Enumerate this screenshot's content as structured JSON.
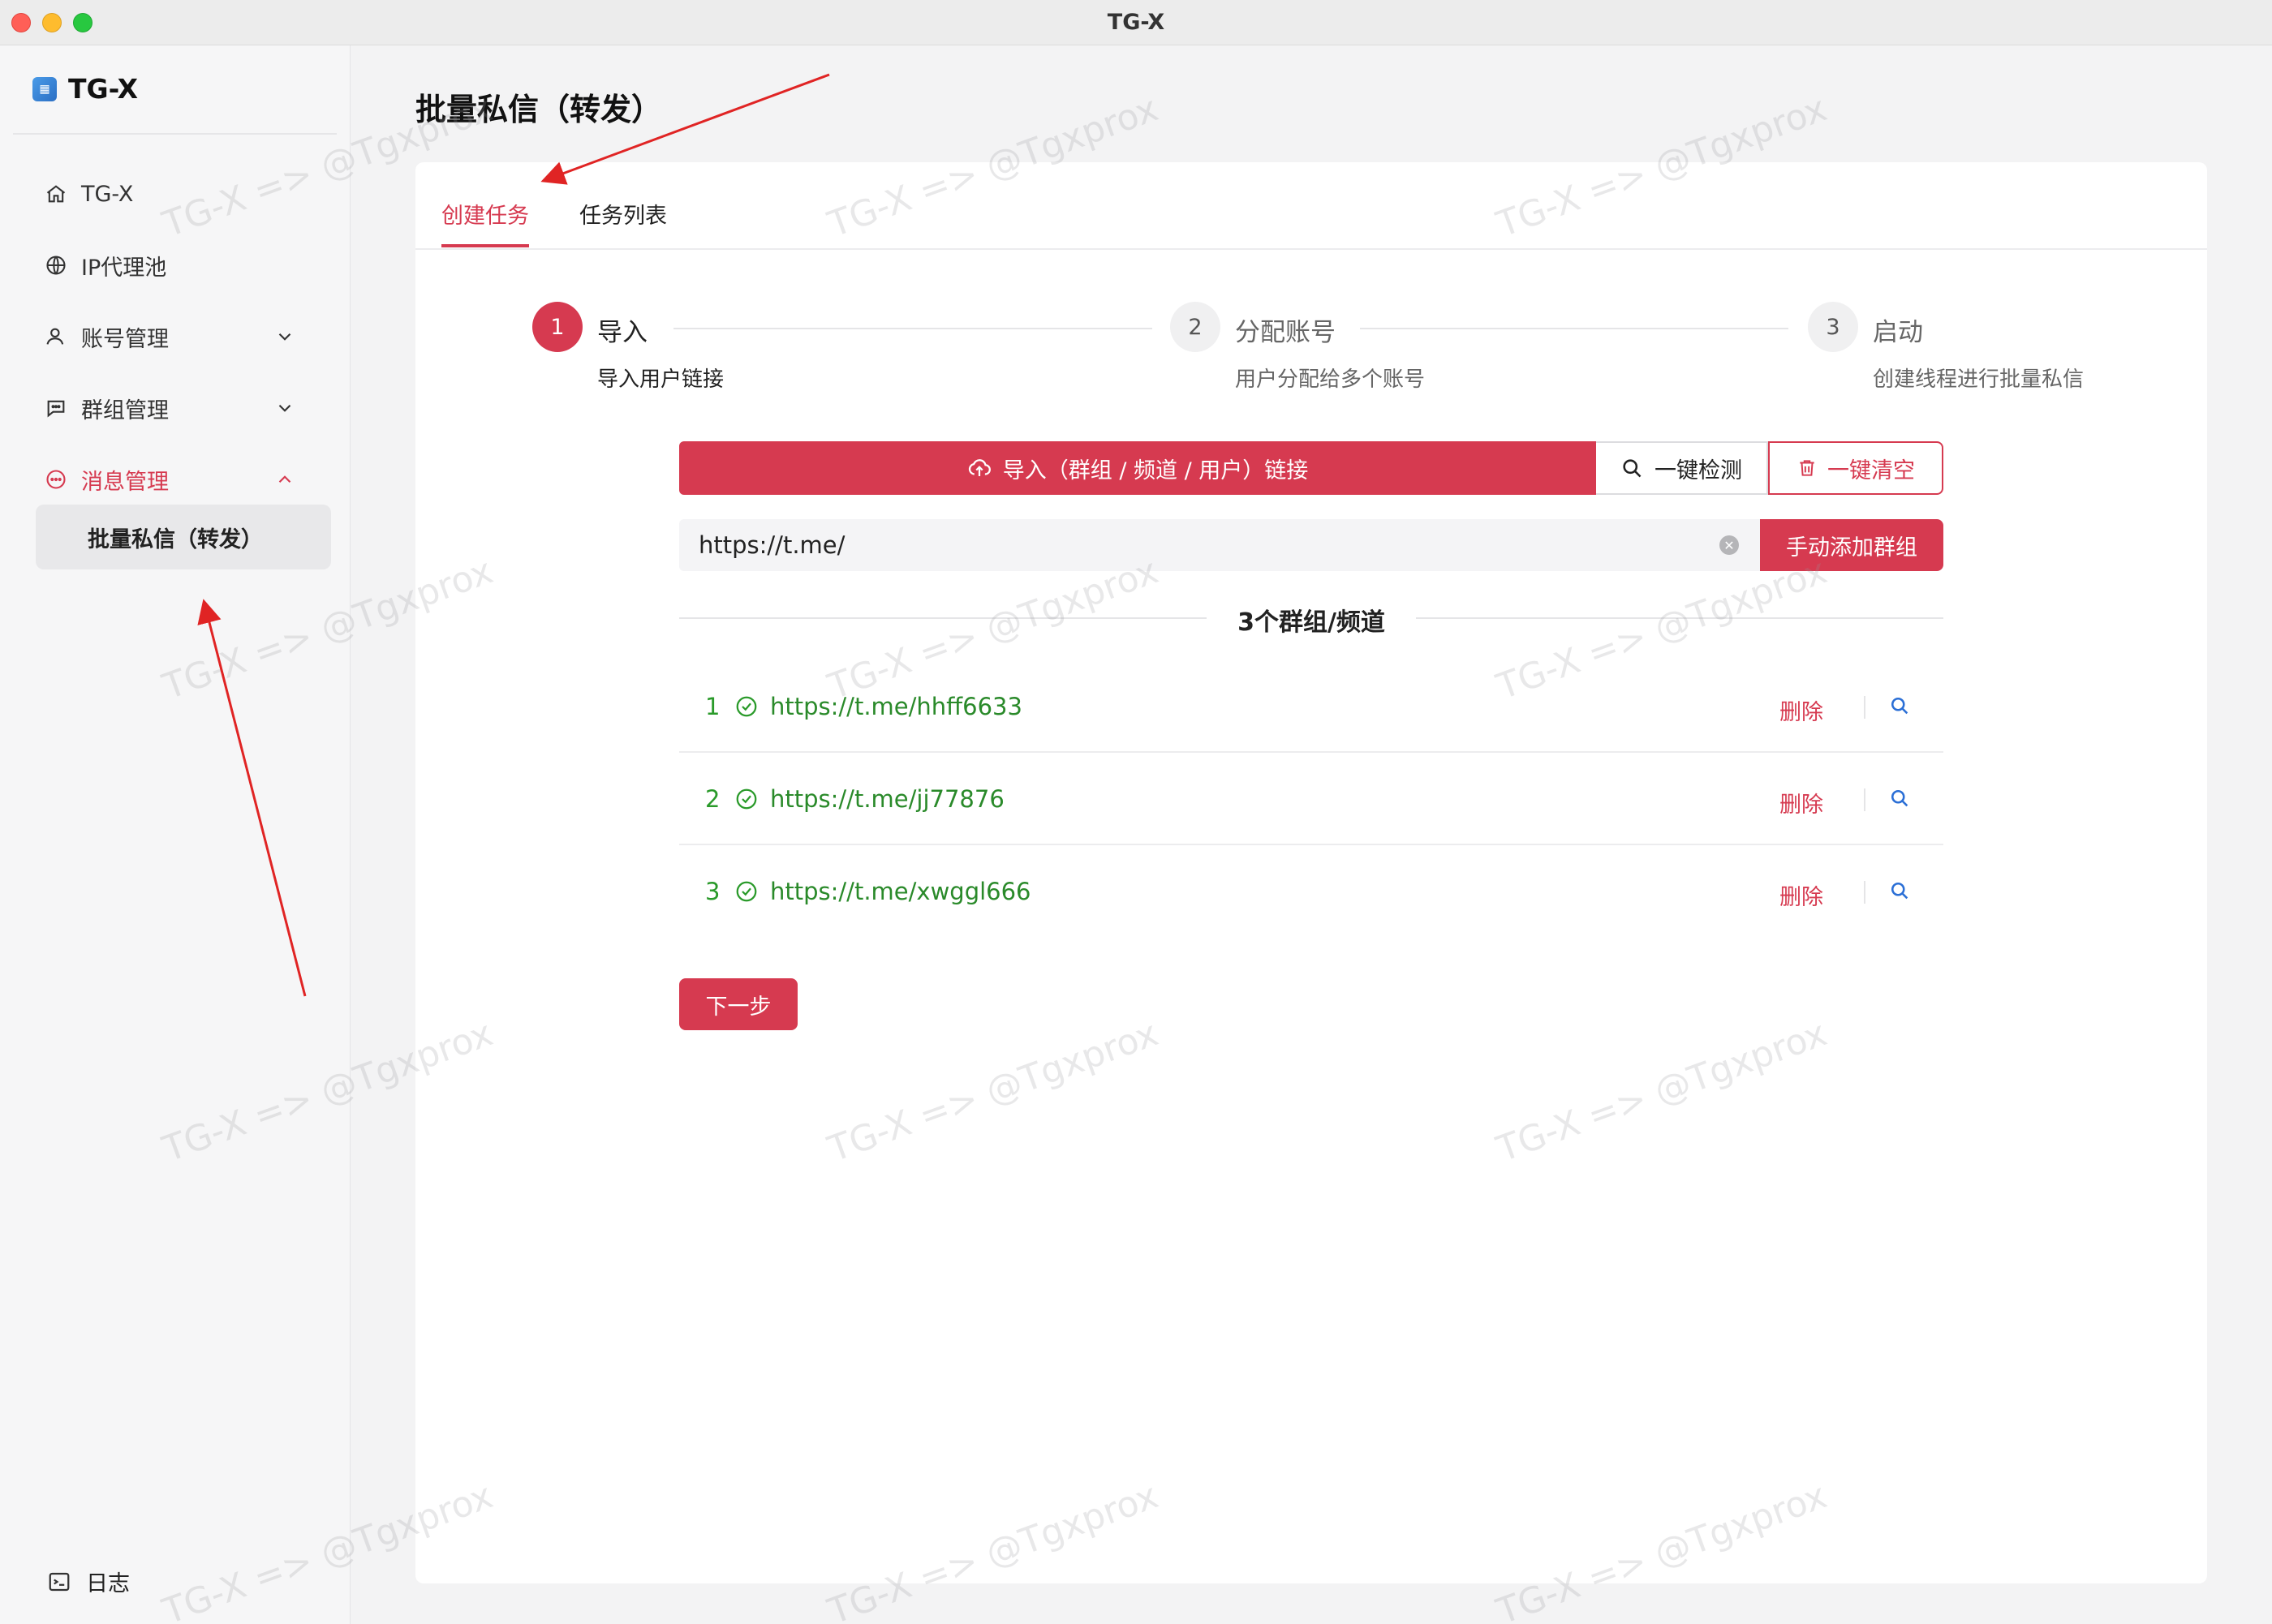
{
  "window": {
    "title": "TG-X"
  },
  "sidebar": {
    "brand": "TG-X",
    "items": [
      {
        "label": "TG-X",
        "icon": "home-icon"
      },
      {
        "label": "IP代理池",
        "icon": "globe-icon"
      },
      {
        "label": "账号管理",
        "icon": "user-icon"
      },
      {
        "label": "群组管理",
        "icon": "chat-group-icon"
      },
      {
        "label": "消息管理",
        "icon": "message-icon"
      }
    ],
    "sub_item": "批量私信（转发）",
    "log": "日志"
  },
  "page": {
    "title": "批量私信（转发）"
  },
  "tabs": [
    {
      "label": "创建任务",
      "active": true
    },
    {
      "label": "任务列表",
      "active": false
    }
  ],
  "steps": [
    {
      "num": "1",
      "title": "导入",
      "desc": "导入用户链接",
      "status": "current"
    },
    {
      "num": "2",
      "title": "分配账号",
      "desc": "用户分配给多个账号",
      "status": "pending"
    },
    {
      "num": "3",
      "title": "启动",
      "desc": "创建线程进行批量私信",
      "status": "pending"
    }
  ],
  "actions": {
    "import_label": "导入（群组 / 频道 / 用户）链接",
    "check_label": "一键检测",
    "clear_label": "一键清空"
  },
  "input": {
    "value": "https://t.me/",
    "add_label": "手动添加群组"
  },
  "list": {
    "count_label": "3个群组/频道",
    "items": [
      {
        "num": "1",
        "url": "https://t.me/hhff6633",
        "delete": "删除"
      },
      {
        "num": "2",
        "url": "https://t.me/jj77876",
        "delete": "删除"
      },
      {
        "num": "3",
        "url": "https://t.me/xwggl666",
        "delete": "删除"
      }
    ]
  },
  "next_label": "下一步",
  "watermark": "TG-X => @Tgxprox",
  "colors": {
    "accent": "#d63a50",
    "success": "#2a8a2a",
    "link_search": "#2b6fd6",
    "annotation_arrow": "#e02424"
  }
}
